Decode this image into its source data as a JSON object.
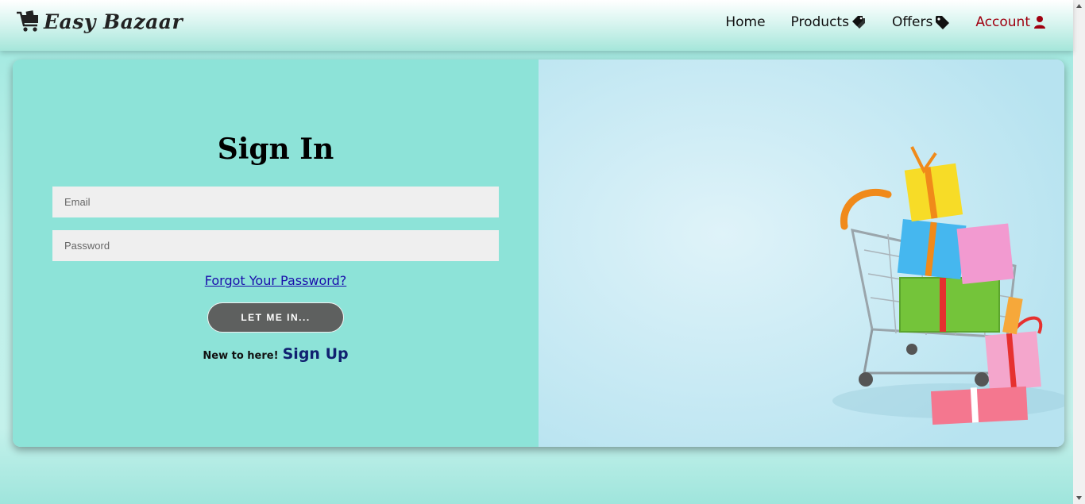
{
  "brand": {
    "name": "Easy Bazaar"
  },
  "nav": {
    "items": [
      {
        "label": "Home",
        "icon": ""
      },
      {
        "label": "Products",
        "icon": "tags-icon"
      },
      {
        "label": "Offers",
        "icon": "tag-icon"
      },
      {
        "label": "Account",
        "icon": "user-icon"
      }
    ]
  },
  "signin": {
    "title": "Sign In",
    "email_placeholder": "Email",
    "password_placeholder": "Password",
    "forgot_label": "Forgot Your Password?",
    "submit_label": "LET ME IN...",
    "new_text": "New to here!",
    "signup_label": "Sign Up"
  },
  "colors": {
    "panel": "#8de3d8",
    "account": "#a00010",
    "button": "#5e605f",
    "signup": "#102070",
    "link": "#1a0dab"
  },
  "image": {
    "description_icon": "shopping-cart-with-gifts-image"
  }
}
